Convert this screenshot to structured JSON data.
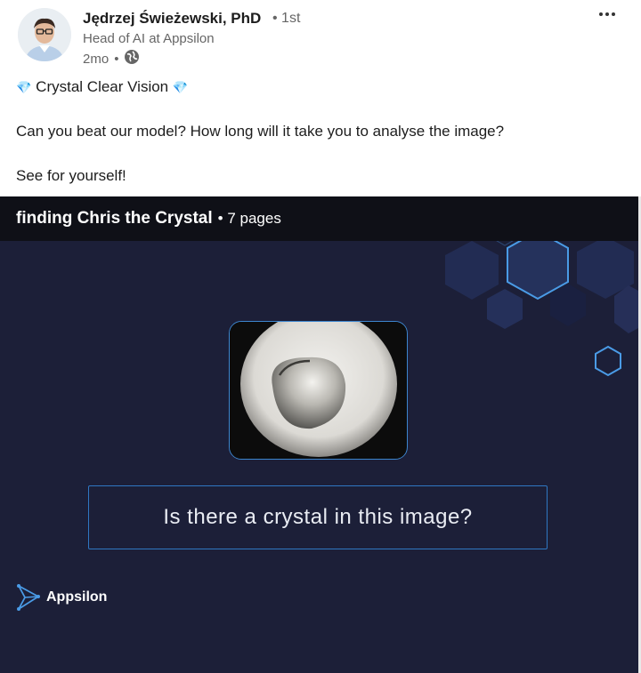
{
  "author": {
    "name": "Jędrzej Świeżewski, PhD",
    "degree": "1st",
    "headline": "Head of AI at Appsilon",
    "time": "2mo",
    "visibility_icon": "globe-icon"
  },
  "post": {
    "title": "Crystal Clear Vision",
    "title_emoji": "💎",
    "question": "Can you beat our model? How long will it take you to analyse the image?",
    "cta": "See for yourself!"
  },
  "document": {
    "title": "finding Chris the Crystal",
    "pages": "7 pages",
    "slide_question": "Is there a crystal in this image?",
    "brand": "Appsilon",
    "accent_color": "#3d86cf",
    "background_color": "#1c1f38"
  },
  "menu": {
    "more_icon": "more-options-icon"
  }
}
